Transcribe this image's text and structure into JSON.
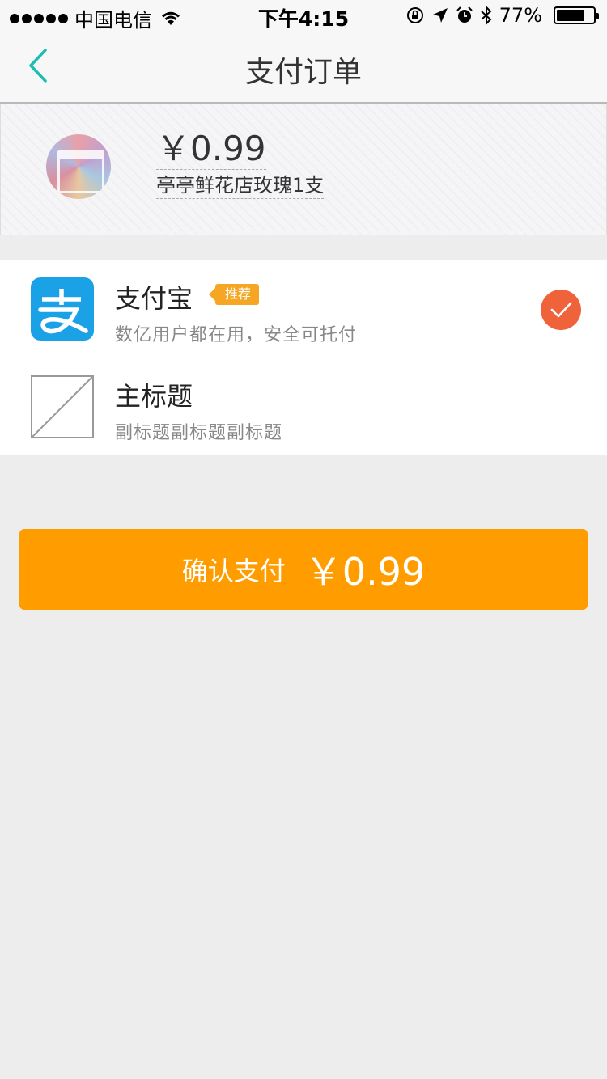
{
  "status_bar": {
    "carrier": "中国电信",
    "time": "下午4:15",
    "battery_text": "77%",
    "battery_level": 0.77
  },
  "nav": {
    "title": "支付订单"
  },
  "order": {
    "amount": "￥0.99",
    "product": "亭亭鲜花店玫瑰1支"
  },
  "payment_methods": [
    {
      "title": "支付宝",
      "badge": "推荐",
      "subtitle": "数亿用户都在用，安全可托付",
      "selected": true,
      "icon": "alipay-icon"
    },
    {
      "title": "主标题",
      "subtitle": "副标题副标题副标题",
      "selected": false,
      "icon": "image-placeholder-icon"
    }
  ],
  "confirm": {
    "label": "确认支付",
    "amount": "￥0.99"
  },
  "colors": {
    "accent": "#ff9c00",
    "check": "#f0623a",
    "alipay": "#1aa1e6",
    "back_arrow": "#1bbfb0"
  }
}
